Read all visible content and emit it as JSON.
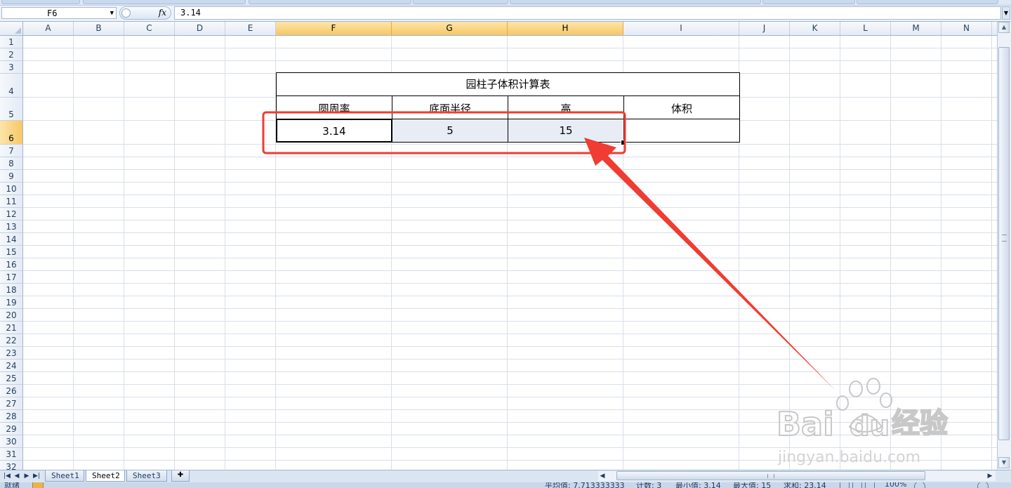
{
  "formula_bar": {
    "name_box": "F6",
    "fx_label": "fx",
    "formula": "3.14"
  },
  "columns": [
    {
      "label": "A"
    },
    {
      "label": "B"
    },
    {
      "label": "C"
    },
    {
      "label": "D"
    },
    {
      "label": "E"
    },
    {
      "label": "F",
      "selected": true
    },
    {
      "label": "G",
      "selected": true
    },
    {
      "label": "H",
      "selected": true
    },
    {
      "label": "I"
    },
    {
      "label": "J"
    },
    {
      "label": "K"
    },
    {
      "label": "L"
    },
    {
      "label": "M"
    },
    {
      "label": "N"
    }
  ],
  "rows": [
    "1",
    "2",
    "3",
    "4",
    "5",
    "6",
    "7",
    "8",
    "9",
    "10",
    "11",
    "12",
    "13",
    "14",
    "15",
    "16",
    "17",
    "18",
    "19",
    "20",
    "21",
    "22",
    "23",
    "24",
    "25",
    "26",
    "27",
    "28",
    "29",
    "30",
    "31",
    "32"
  ],
  "selected_row": "6",
  "table": {
    "title": "园柱子体积计算表",
    "headers": [
      "圆周率",
      "底面半径",
      "高",
      "体积"
    ],
    "values": [
      "3.14",
      "5",
      "15",
      ""
    ]
  },
  "sheet_tabs": [
    {
      "label": "Sheet1",
      "active": false
    },
    {
      "label": "Sheet2",
      "active": true
    },
    {
      "label": "Sheet3",
      "active": false
    }
  ],
  "status_bar": {
    "ready": "就绪",
    "average": "平均值: 7.713333333",
    "count": "计数: 3",
    "min": "最小值: 3.14",
    "max": "最大值: 15",
    "sum": "求和: 23.14",
    "zoom": "100%"
  },
  "annotation": {
    "color": "#f03c32"
  },
  "watermark": {
    "brand": "Bai",
    "brand2": "du",
    "cn": "经验",
    "url": "jingyan.baidu.com"
  }
}
